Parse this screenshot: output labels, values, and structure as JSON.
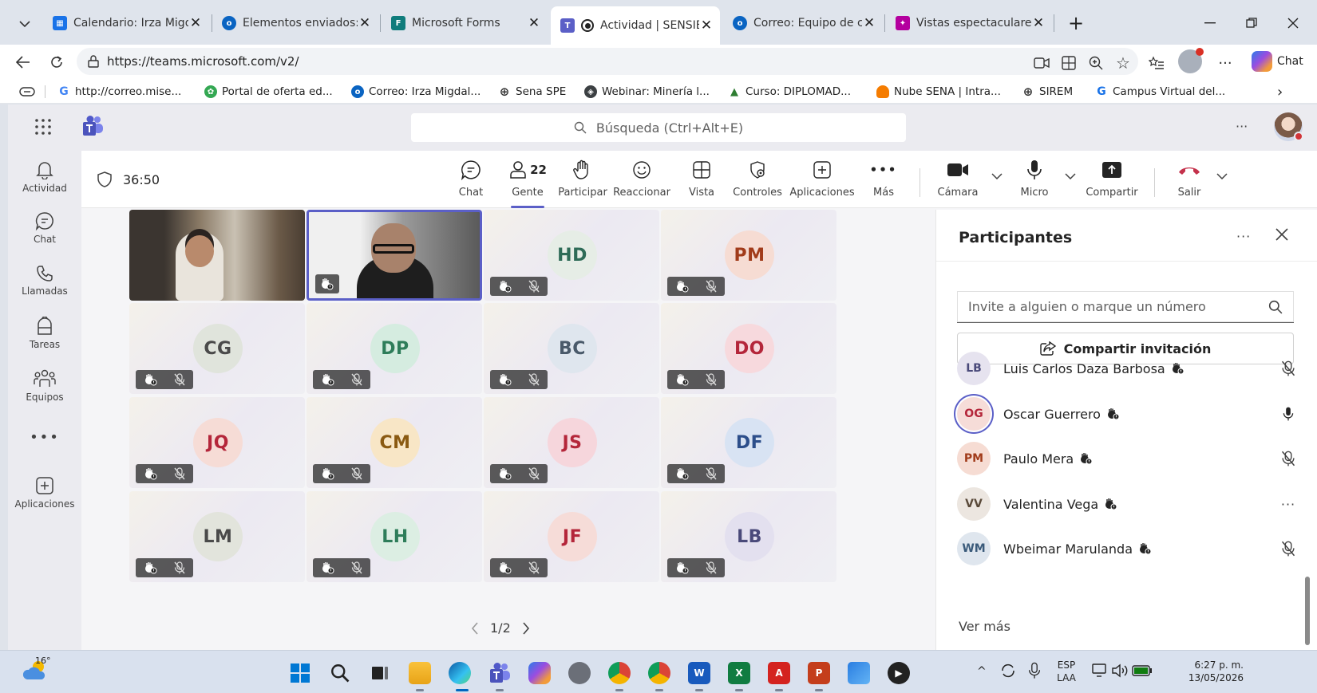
{
  "browser": {
    "tabs": [
      {
        "title": "Calendario: Irza Migdalia",
        "icon_color": "#1a73e8"
      },
      {
        "title": "Elementos enviados: Irza",
        "icon_color": "#0a64c2"
      },
      {
        "title": "Microsoft Forms",
        "icon_color": "#107c7c"
      },
      {
        "title": "Actividad | SENSIBIL",
        "icon_color": "#5b5fc7"
      },
      {
        "title": "Correo: Equipo de cuenta",
        "icon_color": "#0a64c2"
      },
      {
        "title": "Vistas espectaculares de",
        "icon_color": "#b4009e"
      }
    ],
    "close_glyph": "✕",
    "url": "https://teams.microsoft.com/v2/",
    "chat_label": "Chat",
    "bookmarks": [
      {
        "label": "http://correo.mise...",
        "color": "#4285f4",
        "glyph": "G"
      },
      {
        "label": "Portal de oferta ed...",
        "color": "#34a853",
        "glyph": "✿"
      },
      {
        "label": "Correo: Irza Migdal...",
        "color": "#0a64c2",
        "glyph": "o"
      },
      {
        "label": "Sena SPE",
        "color": "#5f6368",
        "glyph": "⊕"
      },
      {
        "label": "Webinar: Minería l...",
        "color": "#3c4043",
        "glyph": "◈"
      },
      {
        "label": "Curso: DIPLOMAD...",
        "color": "#2e7d32",
        "glyph": "▲"
      },
      {
        "label": "Nube SENA | Intra...",
        "color": "#f57c00",
        "glyph": "●"
      },
      {
        "label": "SIREM",
        "color": "#5f6368",
        "glyph": "⊕"
      },
      {
        "label": "Campus Virtual del...",
        "color": "#1a73e8",
        "glyph": "G"
      }
    ]
  },
  "teams": {
    "search_placeholder": "Búsqueda (Ctrl+Alt+E)",
    "rail": [
      {
        "label": "Actividad",
        "icon": "bell-icon"
      },
      {
        "label": "Chat",
        "icon": "chat-icon"
      },
      {
        "label": "Llamadas",
        "icon": "phone-icon"
      },
      {
        "label": "Tareas",
        "icon": "tasks-icon"
      },
      {
        "label": "Equipos",
        "icon": "teams-icon"
      },
      {
        "label": "",
        "icon": "more-icon"
      },
      {
        "label": "Aplicaciones",
        "icon": "apps-icon"
      }
    ]
  },
  "meeting": {
    "timer": "36:50",
    "controls": {
      "chat": "Chat",
      "people": "Gente",
      "people_count": "22",
      "raise": "Participar",
      "react": "Reaccionar",
      "view": "Vista",
      "controls": "Controles",
      "apps": "Aplicaciones",
      "more": "Más",
      "camera": "Cámara",
      "mic": "Micro",
      "share": "Compartir",
      "leave": "Salir"
    },
    "tiles": [
      {
        "initials": "",
        "video": true,
        "bg": "#7a6a5a"
      },
      {
        "initials": "",
        "video": true,
        "bg": "#8e8e8e",
        "active": true
      },
      {
        "initials": "HD",
        "color": "#2e6b57",
        "bg": "#e6ede6"
      },
      {
        "initials": "PM",
        "color": "#a13b1a",
        "bg": "#f6dcd3"
      },
      {
        "initials": "CG",
        "color": "#4a4a4a",
        "bg": "#e0e4dc"
      },
      {
        "initials": "DP",
        "color": "#2e7d5a",
        "bg": "#d5ece0"
      },
      {
        "initials": "BC",
        "color": "#4a5a6a",
        "bg": "#dfe6ee"
      },
      {
        "initials": "DO",
        "color": "#b4263a",
        "bg": "#f7d9dd"
      },
      {
        "initials": "JQ",
        "color": "#b4263a",
        "bg": "#f6dcd6"
      },
      {
        "initials": "CM",
        "color": "#8a5a12",
        "bg": "#f8e6c6"
      },
      {
        "initials": "JS",
        "color": "#b4263a",
        "bg": "#f6d6dc"
      },
      {
        "initials": "DF",
        "color": "#2c4e8a",
        "bg": "#d8e3f3"
      },
      {
        "initials": "LM",
        "color": "#4a4a4a",
        "bg": "#e2e4dc"
      },
      {
        "initials": "LH",
        "color": "#2e7d5a",
        "bg": "#dceee3"
      },
      {
        "initials": "JF",
        "color": "#b4263a",
        "bg": "#f6dcd8"
      },
      {
        "initials": "LB",
        "color": "#4a4a7a",
        "bg": "#e3e0ef"
      }
    ],
    "pager": "1/2"
  },
  "participants": {
    "title": "Participantes",
    "invite_placeholder": "Invite a alguien o marque un número",
    "share_invite": "Compartir invitación",
    "people": [
      {
        "initials": "LB",
        "name": "Luis Carlos Daza Barbosa",
        "status": "muted",
        "av_bg": "#e6e3ef",
        "av_color": "#4a4a7a"
      },
      {
        "initials": "OG",
        "name": "Oscar Guerrero",
        "status": "mic-on",
        "av_bg": "#f6dcd8",
        "av_color": "#b4263a",
        "speaking": true
      },
      {
        "initials": "PM",
        "name": "Paulo Mera",
        "status": "muted",
        "av_bg": "#f6dcd3",
        "av_color": "#a13b1a"
      },
      {
        "initials": "VV",
        "name": "Valentina Vega",
        "status": "more",
        "av_bg": "#ece6e0",
        "av_color": "#5a4a3a"
      },
      {
        "initials": "WM",
        "name": "Wbeimar Marulanda",
        "status": "muted",
        "av_bg": "#dfe6ee",
        "av_color": "#3a5a7a"
      }
    ],
    "see_more": "Ver más"
  },
  "taskbar": {
    "weather": "16°",
    "lang_line1": "ESP",
    "lang_line2": "LAA",
    "time": "6:27 p. m.",
    "date": "13/05/2026"
  },
  "colors": {
    "accent": "#5b5fc7",
    "leave": "#c4314b"
  }
}
